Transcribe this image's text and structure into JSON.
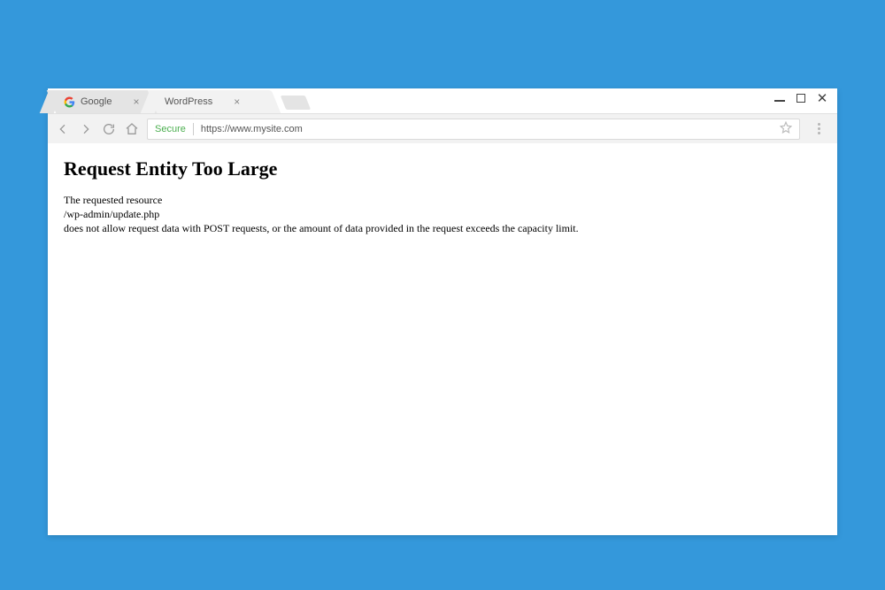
{
  "tabs": [
    {
      "title": "Google",
      "active": false
    },
    {
      "title": "WordPress",
      "active": true
    }
  ],
  "toolbar": {
    "secure_label": "Secure",
    "url": "https://www.mysite.com"
  },
  "page": {
    "heading": "Request Entity Too Large",
    "line1": "The requested resource",
    "line2": "/wp-admin/update.php",
    "line3": "does not allow request data with POST requests, or the amount of data provided in the request exceeds the capacity limit."
  }
}
